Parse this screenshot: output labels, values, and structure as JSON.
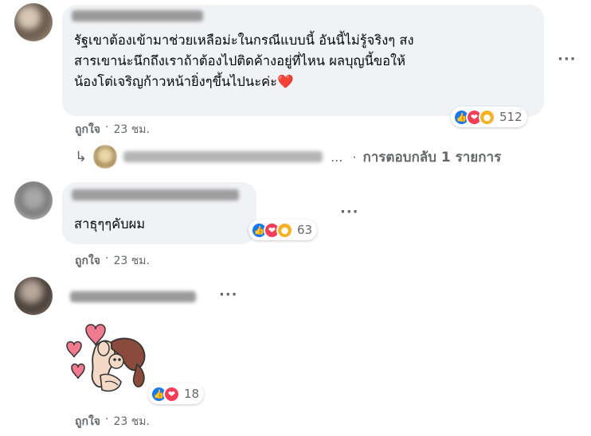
{
  "comments": [
    {
      "text": "รัฐเขาต้องเข้ามาช่วยเหลือม่ะในกรณีแบบนี้ อันนี้ไม่รู้จริงๆ สง\nสารเขาน่ะนึกถึงเราถ้าต้องไปติดค้างอยู่ที่ไหน ผลบุญนี้ขอให้\nน้องโต่เจริญก้าวหน้ายิ่งๆขึ้นไปนะค่ะ❤️",
      "reactions": {
        "icons": [
          "like",
          "love",
          "wow"
        ],
        "count": "512"
      },
      "like_label": "ถูกใจ",
      "separator": "·",
      "time": "23 ชม.",
      "reply_link": "การตอบกลับ 1 รายการ",
      "reply_ellipsis": "..."
    },
    {
      "text": "สาธุๆๆคับผม",
      "reactions": {
        "icons": [
          "like",
          "love",
          "haha"
        ],
        "count": "63"
      },
      "like_label": "ถูกใจ",
      "separator": "·",
      "time": "23 ชม."
    },
    {
      "reactions": {
        "icons": [
          "like",
          "love"
        ],
        "count": "18"
      },
      "like_label": "ถูกใจ",
      "separator": "·",
      "time": "23 ชม."
    }
  ],
  "more_icon": "···",
  "reply_icon": "↳",
  "colors": {
    "bubble": "#f0f2f5",
    "meta": "#65676b",
    "like": "#1877f2",
    "love": "#f33e58",
    "wow": "#f7b125"
  }
}
